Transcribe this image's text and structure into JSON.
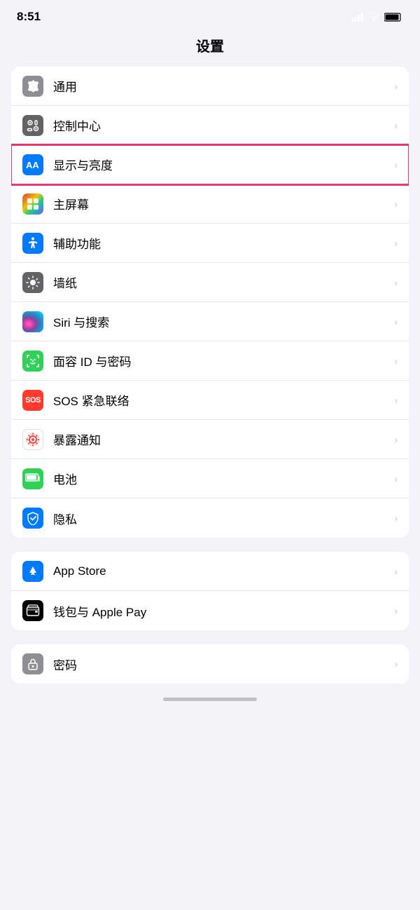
{
  "statusBar": {
    "time": "8:51"
  },
  "pageTitle": "设置",
  "groups": [
    {
      "id": "group1",
      "items": [
        {
          "id": "general",
          "label": "通用",
          "icon": "gear",
          "iconClass": "icon-general"
        },
        {
          "id": "control",
          "label": "控制中心",
          "icon": "control",
          "iconClass": "icon-control"
        },
        {
          "id": "display",
          "label": "显示与亮度",
          "icon": "display",
          "iconClass": "icon-display",
          "highlighted": true
        },
        {
          "id": "home",
          "label": "主屏幕",
          "icon": "home",
          "iconClass": "icon-home"
        },
        {
          "id": "accessibility",
          "label": "辅助功能",
          "icon": "accessibility",
          "iconClass": "icon-accessibility"
        },
        {
          "id": "wallpaper",
          "label": "墙纸",
          "icon": "wallpaper",
          "iconClass": "icon-wallpaper"
        },
        {
          "id": "siri",
          "label": "Siri 与搜索",
          "icon": "siri",
          "iconClass": "icon-siri-bg"
        },
        {
          "id": "faceid",
          "label": "面容 ID 与密码",
          "icon": "faceid",
          "iconClass": "icon-faceid"
        },
        {
          "id": "sos",
          "label": "SOS 紧急联络",
          "icon": "sos",
          "iconClass": "icon-sos"
        },
        {
          "id": "exposure",
          "label": "暴露通知",
          "icon": "exposure",
          "iconClass": "icon-exposure"
        },
        {
          "id": "battery",
          "label": "电池",
          "icon": "battery",
          "iconClass": "icon-battery-icon"
        },
        {
          "id": "privacy",
          "label": "隐私",
          "icon": "privacy",
          "iconClass": "icon-privacy"
        }
      ]
    },
    {
      "id": "group2",
      "items": [
        {
          "id": "appstore",
          "label": "App Store",
          "icon": "appstore",
          "iconClass": "icon-appstore"
        },
        {
          "id": "wallet",
          "label": "钱包与 Apple Pay",
          "icon": "wallet",
          "iconClass": "icon-wallet"
        }
      ]
    },
    {
      "id": "group3",
      "items": [
        {
          "id": "passwords",
          "label": "密码",
          "icon": "passwords",
          "iconClass": "icon-passwords"
        }
      ]
    }
  ],
  "chevron": "›"
}
